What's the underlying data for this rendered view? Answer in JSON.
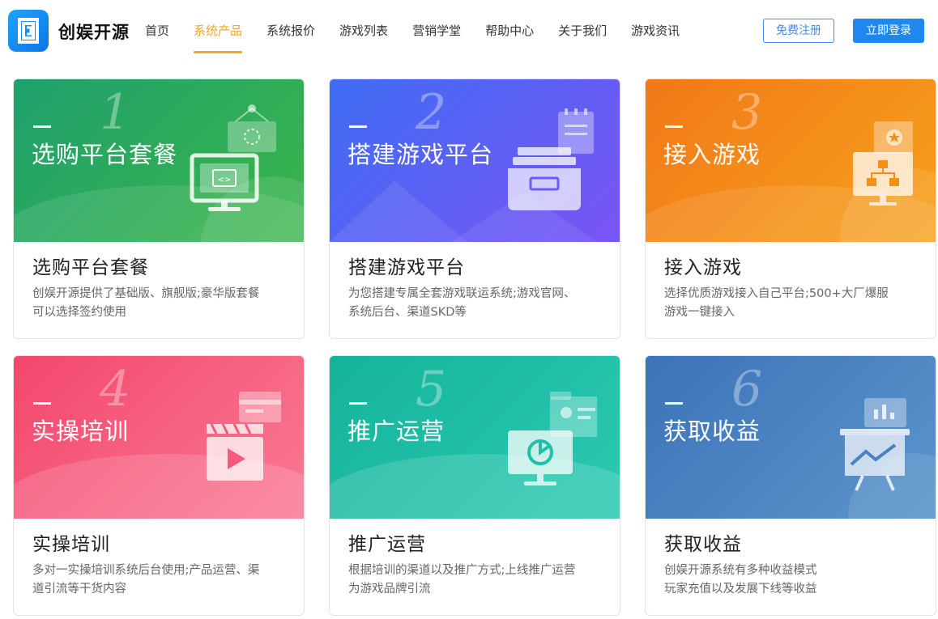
{
  "brand": {
    "name": "创娱开源"
  },
  "nav": [
    {
      "label": "首页",
      "active": false
    },
    {
      "label": "系统产品",
      "active": true
    },
    {
      "label": "系统报价",
      "active": false
    },
    {
      "label": "游戏列表",
      "active": false
    },
    {
      "label": "营销学堂",
      "active": false
    },
    {
      "label": "帮助中心",
      "active": false
    },
    {
      "label": "关于我们",
      "active": false
    },
    {
      "label": "游戏资讯",
      "active": false
    }
  ],
  "actions": {
    "register": "免费注册",
    "login": "立即登录"
  },
  "colors": {
    "accent": "#f5a623",
    "primary": "#1e88f0"
  },
  "cards": [
    {
      "num": "1",
      "banner_title": "选购平台套餐",
      "title": "选购平台套餐",
      "desc_line1": "创娱开源提供了基础版、旗舰版;豪华版套餐",
      "desc_line2": "可以选择签约使用",
      "icon": "monitor-code-icon"
    },
    {
      "num": "2",
      "banner_title": "搭建游戏平台",
      "title": "搭建游戏平台",
      "desc_line1": "为您搭建专属全套游戏联运系统;游戏官网、",
      "desc_line2": "系统后台、渠道SKD等",
      "icon": "cabinet-icon"
    },
    {
      "num": "3",
      "banner_title": "接入游戏",
      "title": "接入游戏",
      "desc_line1": "选择优质游戏接入自己平台;500+大厂爆服",
      "desc_line2": "游戏一键接入",
      "icon": "network-monitor-icon"
    },
    {
      "num": "4",
      "banner_title": "实操培训",
      "title": "实操培训",
      "desc_line1": "多对一实操培训系统后台使用;产品运营、渠",
      "desc_line2": "道引流等干货内容",
      "icon": "video-clapper-icon"
    },
    {
      "num": "5",
      "banner_title": "推广运营",
      "title": "推广运营",
      "desc_line1": "根据培训的渠道以及推广方式;上线推广运营",
      "desc_line2": "为游戏品牌引流",
      "icon": "monitor-chart-icon"
    },
    {
      "num": "6",
      "banner_title": "获取收益",
      "title": "获取收益",
      "desc_line1": "创娱开源系统有多种收益模式",
      "desc_line2": "玩家充值以及发展下线等收益",
      "icon": "easel-chart-icon"
    }
  ]
}
